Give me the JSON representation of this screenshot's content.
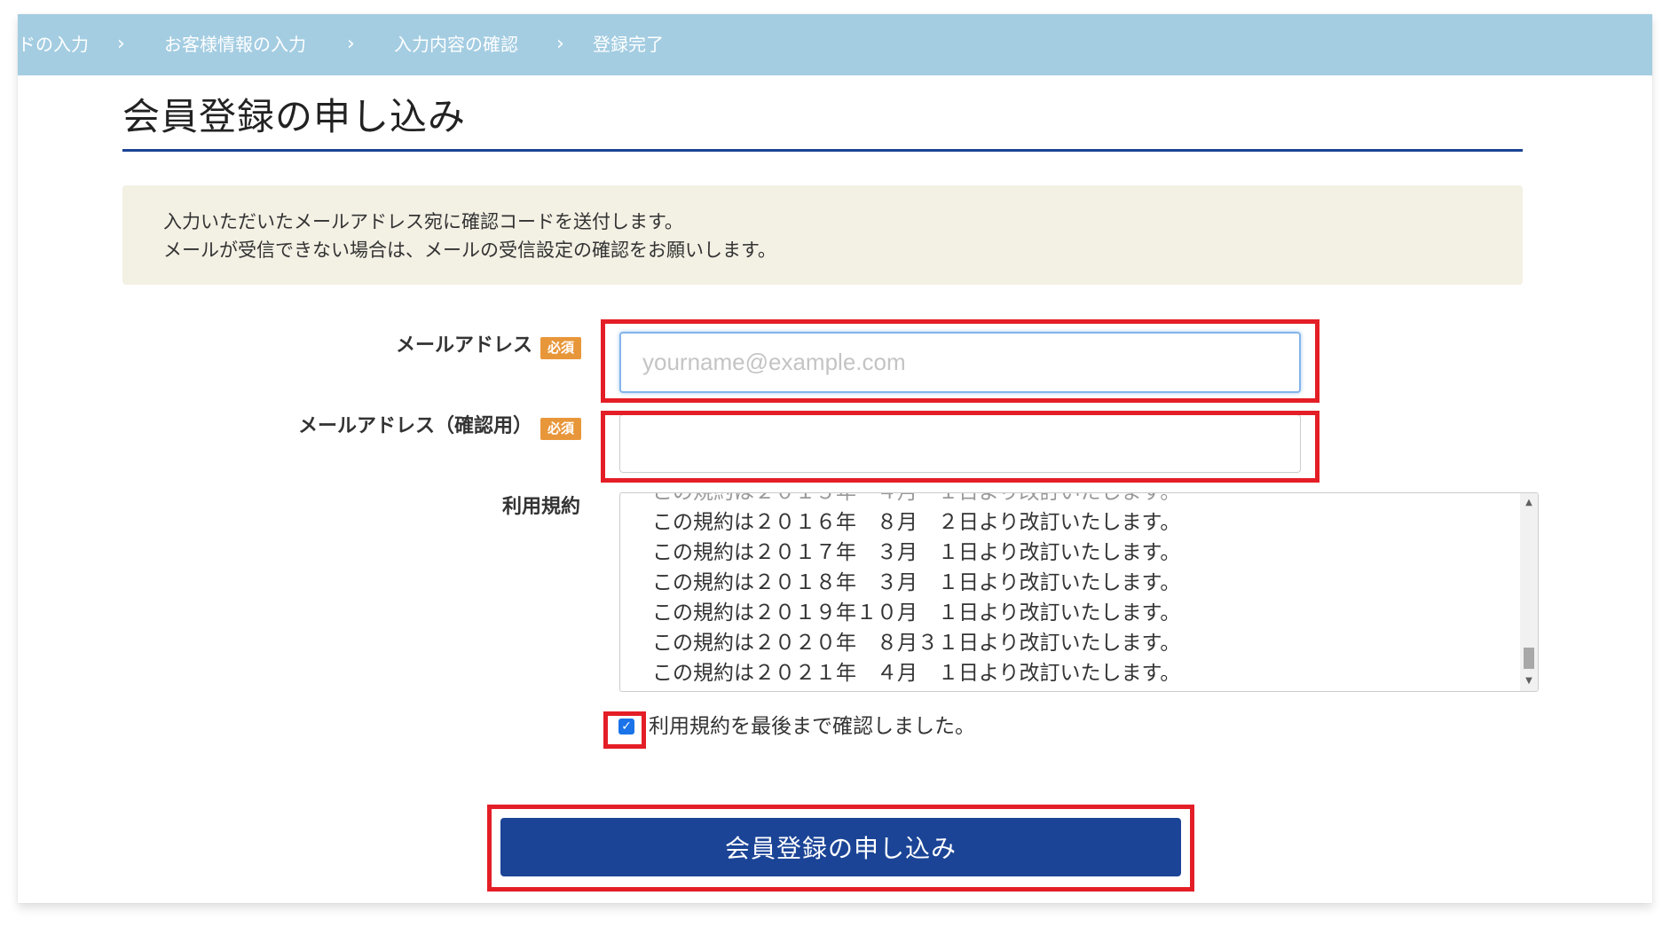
{
  "breadcrumb": {
    "items": [
      "ドの入力",
      "お客様情報の入力",
      "入力内容の確認",
      "登録完了"
    ],
    "separator": "›"
  },
  "page": {
    "title": "会員登録の申し込み"
  },
  "notice": {
    "lines": [
      "入力いただいたメールアドレス宛に確認コードを送付します。",
      "メールが受信できない場合は、メールの受信設定の確認をお願いします。"
    ]
  },
  "form": {
    "email": {
      "label": "メールアドレス",
      "badge": "必須",
      "placeholder": "yourname@example.com",
      "value": ""
    },
    "email_confirm": {
      "label": "メールアドレス（確認用）",
      "badge": "必須",
      "placeholder": "",
      "value": ""
    },
    "terms": {
      "label": "利用規約",
      "lines": [
        "この規約は２０１６年　８月　２日より改訂いたします。",
        "この規約は２０１７年　３月　１日より改訂いたします。",
        "この規約は２０１８年　３月　１日より改訂いたします。",
        "この規約は２０１９年１０月　１日より改訂いたします。",
        "この規約は２０２０年　８月３１日より改訂いたします。",
        "この規約は２０２１年　４月　１日より改訂いたします。"
      ]
    },
    "agree": {
      "label": "利用規約を最後まで確認しました。",
      "checked": true
    },
    "submit_label": "会員登録の申し込み"
  },
  "colors": {
    "breadcrumb_bg": "#a4cde2",
    "brand_navy": "#1b4496",
    "required_badge": "#e8963a",
    "notice_bg": "#f3f0e4",
    "highlight_red": "#e41e26"
  }
}
